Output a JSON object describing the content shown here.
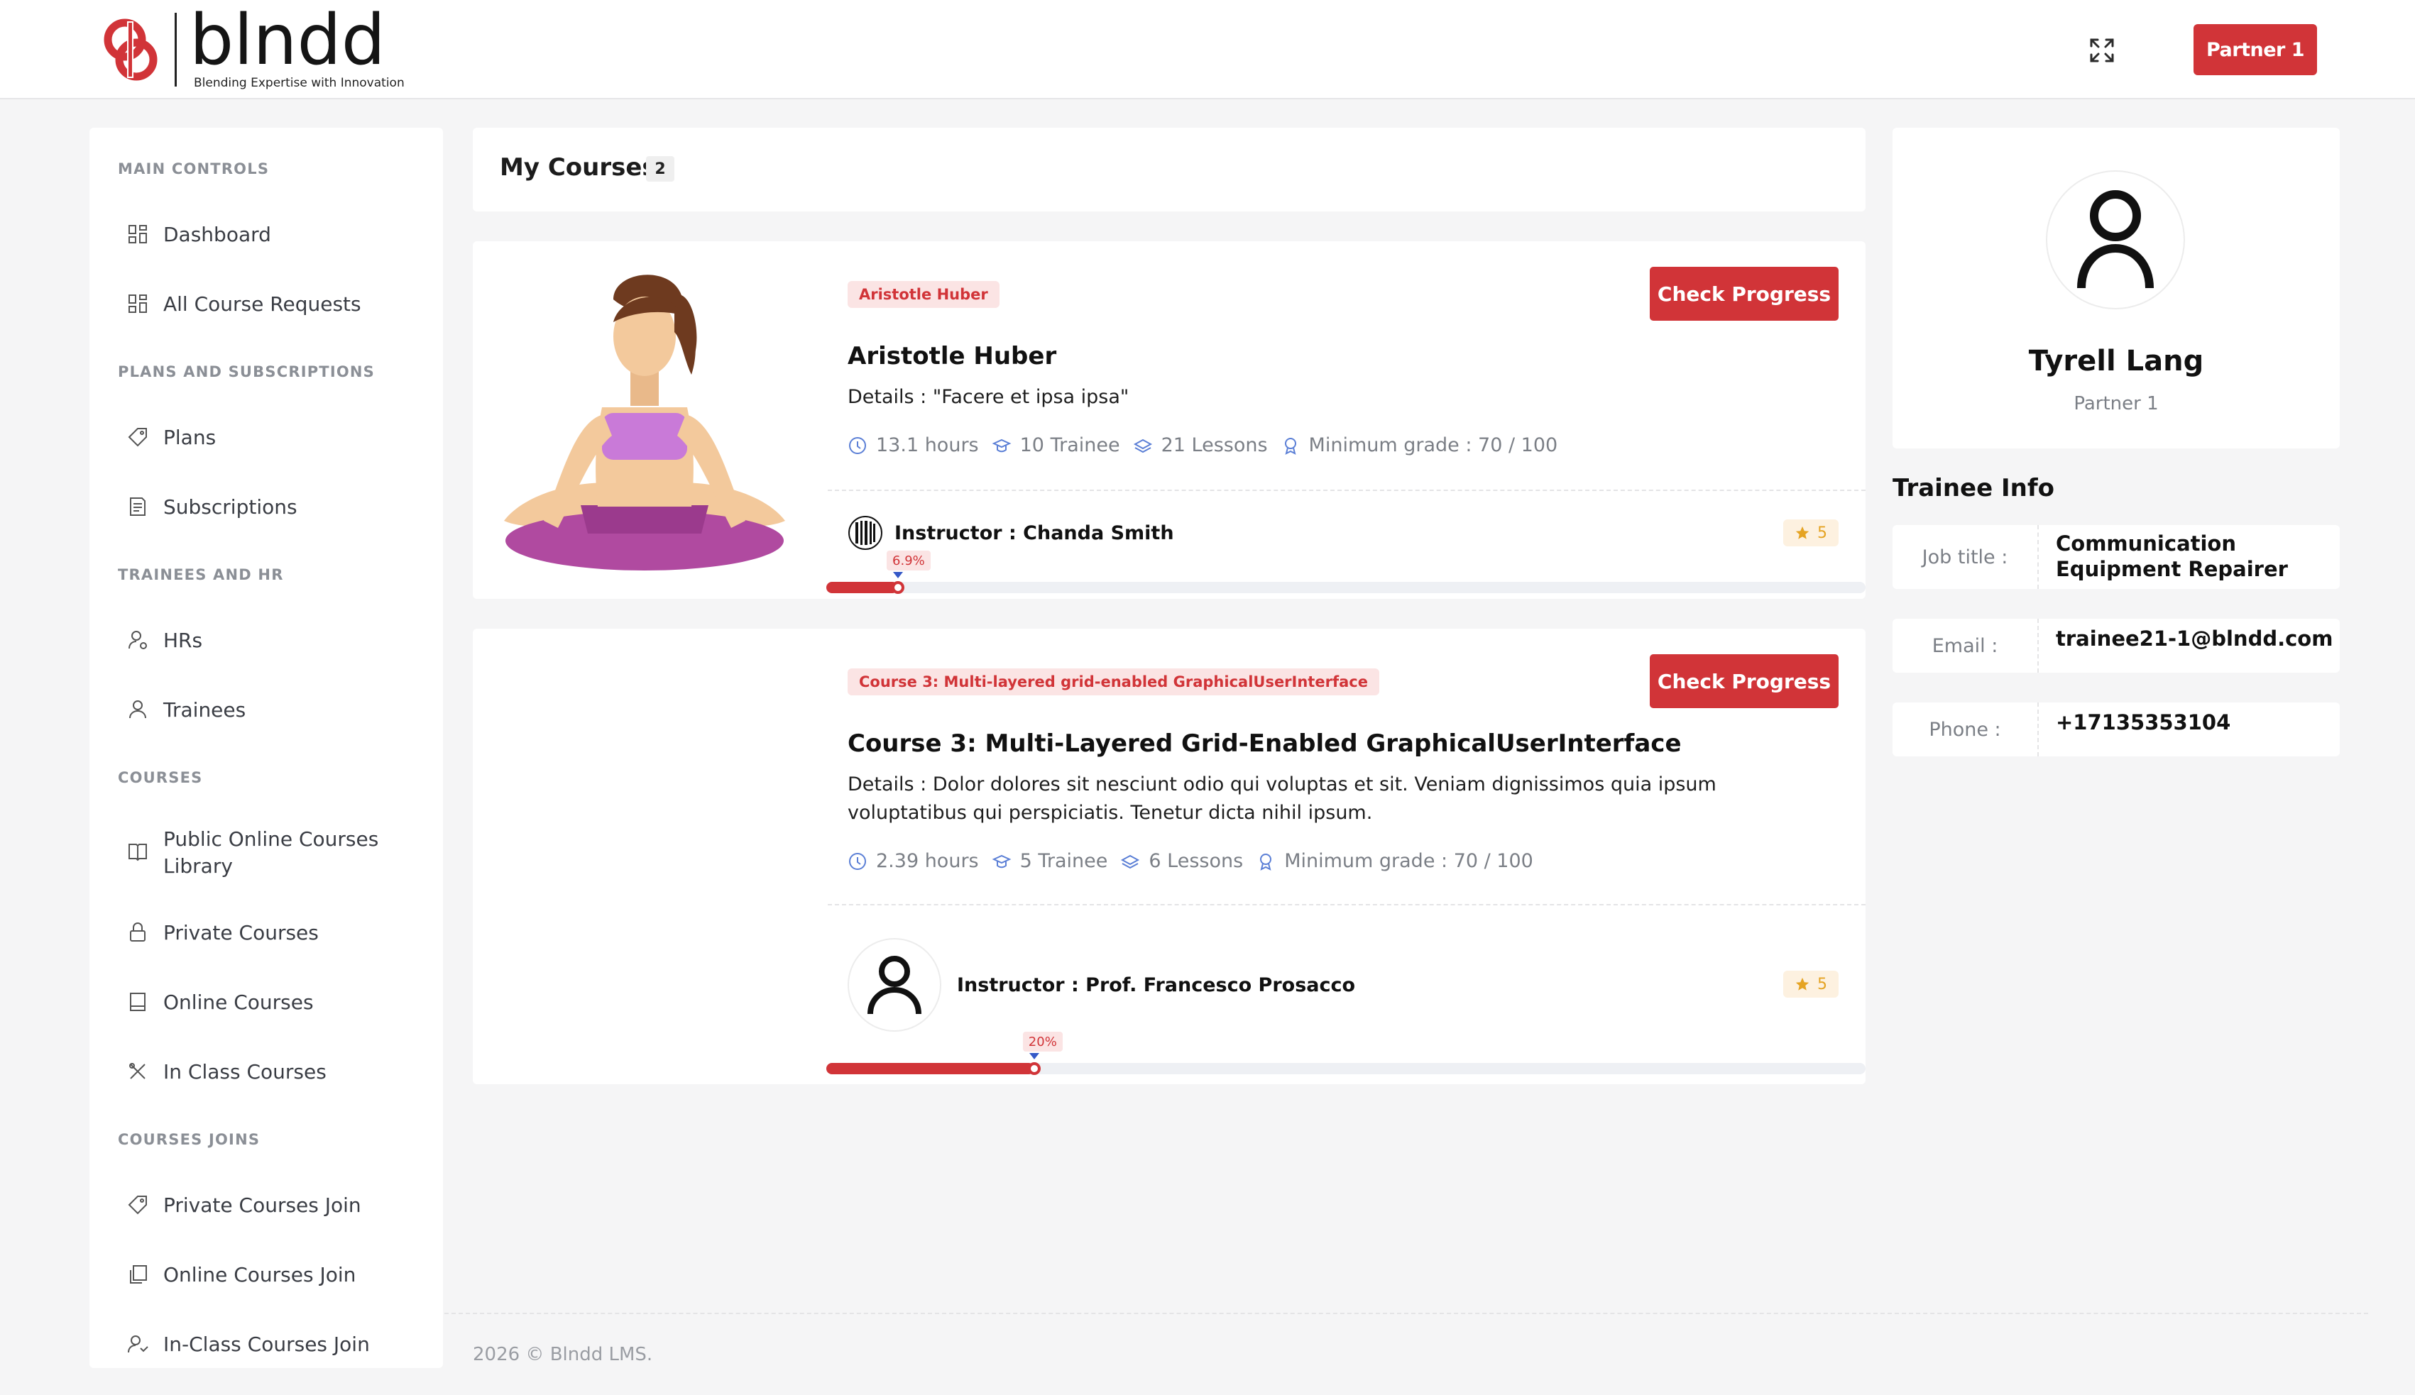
{
  "header": {
    "logo_word": "blndd",
    "logo_tagline": "Blending Expertise with  Innovation",
    "fullscreen_icon": "expand-icon",
    "partner_button": "Partner 1",
    "accent_color": "#d13438"
  },
  "sidebar": {
    "sections": [
      {
        "title": "MAIN CONTROLS",
        "items": [
          {
            "label": "Dashboard",
            "icon": "grid-icon"
          },
          {
            "label": "All Course Requests",
            "icon": "grid-icon"
          }
        ]
      },
      {
        "title": "PLANS AND SUBSCRIPTIONS",
        "items": [
          {
            "label": "Plans",
            "icon": "tag-icon"
          },
          {
            "label": "Subscriptions",
            "icon": "receipt-icon"
          }
        ]
      },
      {
        "title": "TRAINEES AND HR",
        "items": [
          {
            "label": "HRs",
            "icon": "user-gear-icon"
          },
          {
            "label": "Trainees",
            "icon": "user-icon"
          }
        ]
      },
      {
        "title": "COURSES",
        "items": [
          {
            "label": "Public Online Courses Library",
            "icon": "book-open-icon"
          },
          {
            "label": "Private Courses",
            "icon": "lock-icon"
          },
          {
            "label": "Online Courses",
            "icon": "book-icon"
          },
          {
            "label": "In Class Courses",
            "icon": "tools-icon"
          }
        ]
      },
      {
        "title": "COURSES JOINS",
        "items": [
          {
            "label": "Private Courses Join",
            "icon": "tag-icon"
          },
          {
            "label": "Online Courses Join",
            "icon": "copy-icon"
          },
          {
            "label": "In-Class Courses Join",
            "icon": "users-icon"
          }
        ]
      }
    ]
  },
  "main": {
    "title": "My Courses",
    "count": "2",
    "courses": [
      {
        "tag": "Aristotle Huber",
        "title": "Aristotle Huber",
        "details": "Details : \"Facere et ipsa ipsa\"",
        "hours": "13.1 hours",
        "trainees": "10 Trainee",
        "lessons": "21 Lessons",
        "grade": "Minimum grade : 70 / 100",
        "instructor": "Instructor : Chanda Smith",
        "rating": "5",
        "progress_label": "6.9%",
        "progress": 6.9,
        "button": "Check Progress",
        "image": "yoga-illustration"
      },
      {
        "tag": "Course 3: Multi-layered grid-enabled GraphicalUserInterface",
        "title": "Course 3: Multi-Layered Grid-Enabled GraphicalUserInterface",
        "details": "Details : Dolor dolores sit nesciunt odio qui voluptas et sit. Veniam dignissimos quia ipsum voluptatibus qui perspiciatis. Tenetur dicta nihil ipsum.",
        "hours": "2.39 hours",
        "trainees": "5 Trainee",
        "lessons": "6 Lessons",
        "grade": "Minimum grade : 70 / 100",
        "instructor": "Instructor : Prof. Francesco Prosacco",
        "rating": "5",
        "progress_label": "20%",
        "progress": 20,
        "button": "Check Progress",
        "image": "none"
      }
    ]
  },
  "profile": {
    "name": "Tyrell Lang",
    "role": "Partner 1",
    "info_title": "Trainee Info",
    "job_title_label": "Job title :",
    "job_title": "Communication Equipment Repairer",
    "email_label": "Email :",
    "email": "trainee21-1@blndd.com",
    "phone_label": "Phone :",
    "phone": "+17135353104"
  },
  "footer": {
    "text": "2026 © Blndd LMS."
  }
}
